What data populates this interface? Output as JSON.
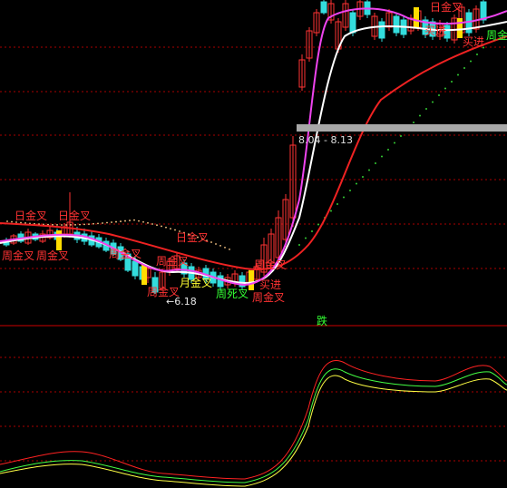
{
  "chart_data": {
    "type": "line",
    "title": "",
    "panels": [
      "price",
      "indicator"
    ],
    "price_range_label": "8.04 - 8.13",
    "low_label": "←6.18",
    "signal_label": "跌",
    "annotations": [
      {
        "text": "日金叉",
        "color": "#ff3333"
      },
      {
        "text": "周金叉",
        "color": "#ff3333"
      },
      {
        "text": "日金叉",
        "color": "#ff3333"
      },
      {
        "text": "周金叉",
        "color": "#ff3333"
      },
      {
        "text": "日金叉",
        "color": "#ff3333"
      },
      {
        "text": "周金叉",
        "color": "#ff3333"
      },
      {
        "text": "周金叉",
        "color": "#ff3333"
      },
      {
        "text": "月金叉",
        "color": "#ffff33"
      },
      {
        "text": "周死叉",
        "color": "#33ff33"
      },
      {
        "text": "周金叉",
        "color": "#ff3333"
      },
      {
        "text": "周金叉",
        "color": "#ff3333"
      },
      {
        "text": "买进",
        "color": "#ff3333"
      },
      {
        "text": "周金叉",
        "color": "#ff3333"
      },
      {
        "text": "周金叉",
        "color": "#33ff33"
      },
      {
        "text": "日金叉",
        "color": "#ff3333"
      },
      {
        "text": "买进",
        "color": "#ff3333"
      },
      {
        "text": "买进",
        "color": "#ff3333"
      }
    ],
    "colors": {
      "up": "#ff3333",
      "down": "#33dddd",
      "ma_white": "#ffffff",
      "ma_magenta": "#ee44ee",
      "ma_red": "#ee2222",
      "dots": "#33cc33",
      "osc_red": "#ff2222",
      "osc_green": "#44ff44",
      "osc_yellow": "#ffff44",
      "grid": "#aa0000"
    }
  }
}
